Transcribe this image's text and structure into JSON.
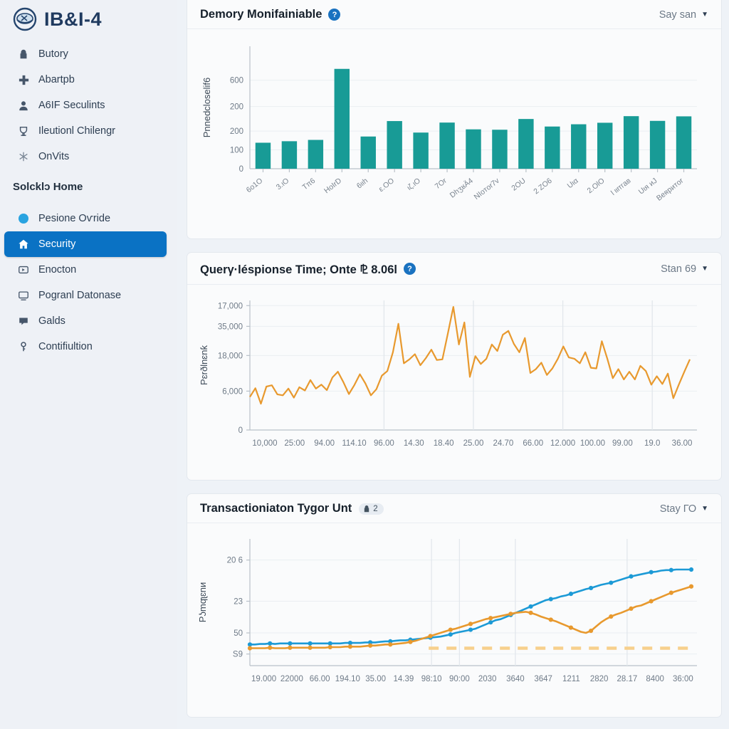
{
  "sidebar": {
    "brand": {
      "title": "IB&I-4",
      "logo_icon": "shield-globe-logo"
    },
    "items_top": [
      {
        "label": "Butory",
        "icon": "lock-icon"
      },
      {
        "label": "Abartpb",
        "icon": "plus-cross-icon"
      },
      {
        "label": "A6IF Seculints",
        "icon": "user-icon"
      },
      {
        "label": "Ileutionl Chilengr",
        "icon": "trophy-icon"
      },
      {
        "label": "OnVits",
        "icon": "snowflake-icon"
      }
    ],
    "section_label": "Solcklɔ Home",
    "items_bottom": [
      {
        "label": "Pesione Oѵride",
        "icon": "blue-dot-icon",
        "active": false
      },
      {
        "label": "Security",
        "icon": "home-icon",
        "active": true
      },
      {
        "label": "Enocton",
        "icon": "play-box-icon",
        "active": false
      },
      {
        "label": "Pogranl Datonase",
        "icon": "monitor-icon",
        "active": false
      },
      {
        "label": "Galds",
        "icon": "chat-icon",
        "active": false
      },
      {
        "label": "Contifiultion",
        "icon": "key-icon",
        "active": false
      }
    ],
    "active_color": "#0a72c4"
  },
  "cards": [
    {
      "title": "Demory Monifainiable",
      "help_icon": "help-circle-icon",
      "badge": null,
      "range_label": "Say san",
      "caret_icon": "chevron-down-icon"
    },
    {
      "title": "Querγ·léspionse Time; Onte ⅊ 8.06l",
      "help_icon": "help-circle-icon",
      "badge": null,
      "range_label": "Stan 69",
      "caret_icon": "chevron-down-icon"
    },
    {
      "title": "Transactioniaton Tygor Unt",
      "help_icon": null,
      "badge": {
        "icon": "lock-icon",
        "text": "2"
      },
      "range_label": "Stay ГО",
      "caret_icon": "chevron-down-icon"
    }
  ],
  "chart_data": [
    {
      "type": "bar",
      "title": "Demory Monifainiable",
      "xlabel": "",
      "ylabel": "Pnnedcloselif6",
      "ylim": [
        0,
        650
      ],
      "yticks": [
        0,
        100,
        200,
        200,
        600
      ],
      "ytick_labels": [
        "0",
        "100",
        "200",
        "200",
        "600"
      ],
      "grid": true,
      "color": "#189b96",
      "categories": [
        "6o1O",
        "3.ιO",
        "Tπ6",
        "HoIrD",
        "6ιιh",
        "ε.OO",
        "ιζ.ιO",
        "7Or",
        "DhʒʁÄ4",
        "NIoтor7v",
        "2OU",
        "2 ZO6",
        "Uια",
        "2.OlO",
        "l ιιrrгав",
        "Uιя иJ",
        "Beʀритor"
      ],
      "values": [
        138,
        146,
        153,
        530,
        171,
        253,
        192,
        245,
        209,
        207,
        264,
        224,
        236,
        244,
        279,
        254,
        278
      ]
    },
    {
      "type": "line",
      "title": "Querγ·léspionse Time; Onte ⅊ 8.06l",
      "xlabel": "",
      "ylabel": "Pɛrðlnɛnƙ",
      "ylim": [
        0,
        20000
      ],
      "yticks": [
        0,
        6000,
        18000,
        35000,
        17000
      ],
      "ytick_labels": [
        "0",
        "6,000",
        "18,000",
        "35,000",
        "17,000"
      ],
      "grid": true,
      "color": "#e8992e",
      "xtick_labels": [
        "10,000",
        "25:00",
        "94.00",
        "114.10",
        "96.00",
        "14.30",
        "18.40",
        "25.00",
        "24.70",
        "66.00",
        "12.000",
        "100.00",
        "99.00",
        "19.0",
        "36.00"
      ],
      "values": [
        5100,
        6450,
        4050,
        6700,
        6900,
        5500,
        5350,
        6400,
        5000,
        6600,
        6100,
        7700,
        6400,
        7000,
        6150,
        8100,
        9000,
        7400,
        5550,
        6950,
        8600,
        7200,
        5350,
        6300,
        8400,
        9100,
        12000,
        16400,
        10300,
        10900,
        11700,
        10000,
        11100,
        12400,
        10800,
        10900,
        14900,
        19000,
        13200,
        16600,
        8200,
        11400,
        10200,
        11000,
        13200,
        12200,
        14700,
        15300,
        13300,
        12000,
        14200,
        8800,
        9400,
        10400,
        8500,
        9500,
        11000,
        12900,
        11200,
        11000,
        10300,
        12000,
        9600,
        9500,
        13700,
        11000,
        8000,
        9400,
        7800,
        9000,
        7800,
        9900,
        9100,
        7000,
        8300,
        7100,
        8700,
        4900,
        7000,
        9000,
        10900
      ],
      "vrules": [
        4,
        7,
        10,
        13
      ]
    },
    {
      "type": "line",
      "title": "Transactioniaton Tygor Unt",
      "xlabel": "",
      "ylabel": "Pʖmqʅɛnи",
      "ylim": [
        0,
        240
      ],
      "yticks": [
        59,
        50,
        23,
        206
      ],
      "ytick_labels": [
        "S9",
        "50",
        "23",
        "20 6"
      ],
      "grid": true,
      "xtick_labels": [
        "19.000",
        "22000",
        "66.00",
        "194.10",
        "35.00",
        "14.39",
        "98:10",
        "90:00",
        "2030",
        "3640",
        "3647",
        "1211",
        "2820",
        "28.17",
        "8400",
        "36:00"
      ],
      "series": [
        {
          "name": "series-blue",
          "color": "#1c9ad6",
          "values": [
            40,
            40,
            41,
            41,
            42,
            41,
            42,
            42,
            42,
            42,
            42,
            42,
            42,
            42,
            42,
            42,
            42,
            42,
            42,
            43,
            43,
            43,
            43,
            44,
            44,
            44,
            45,
            46,
            46,
            47,
            48,
            48,
            49,
            50,
            51,
            52,
            53,
            54,
            55,
            57,
            59,
            62,
            64,
            66,
            68,
            70,
            74,
            78,
            82,
            86,
            88,
            92,
            96,
            100,
            104,
            108,
            112,
            116,
            120,
            124,
            126,
            128,
            131,
            133,
            136,
            139,
            142,
            145,
            147,
            150,
            153,
            155,
            157,
            160,
            163,
            166,
            169,
            171,
            173,
            175,
            177,
            178,
            180,
            181,
            181,
            182,
            182,
            182,
            182
          ]
        },
        {
          "name": "series-orange",
          "color": "#e8992e",
          "values": [
            33,
            33,
            33,
            33,
            34,
            33,
            33,
            33,
            34,
            34,
            34,
            34,
            34,
            34,
            34,
            34,
            35,
            35,
            35,
            36,
            36,
            36,
            36,
            37,
            38,
            38,
            39,
            40,
            40,
            41,
            42,
            43,
            45,
            47,
            50,
            53,
            56,
            59,
            62,
            65,
            68,
            70,
            73,
            76,
            79,
            82,
            85,
            88,
            90,
            92,
            94,
            96,
            98,
            100,
            101,
            102,
            100,
            97,
            93,
            90,
            87,
            84,
            80,
            76,
            72,
            68,
            64,
            62,
            66,
            74,
            82,
            88,
            93,
            97,
            100,
            104,
            108,
            112,
            114,
            118,
            122,
            126,
            130,
            134,
            138,
            141,
            144,
            147,
            150
          ]
        }
      ],
      "threshold": {
        "value": 33,
        "color": "#f7d08c",
        "style": "dashed"
      },
      "vrules": [
        6,
        7,
        9,
        13
      ]
    }
  ]
}
